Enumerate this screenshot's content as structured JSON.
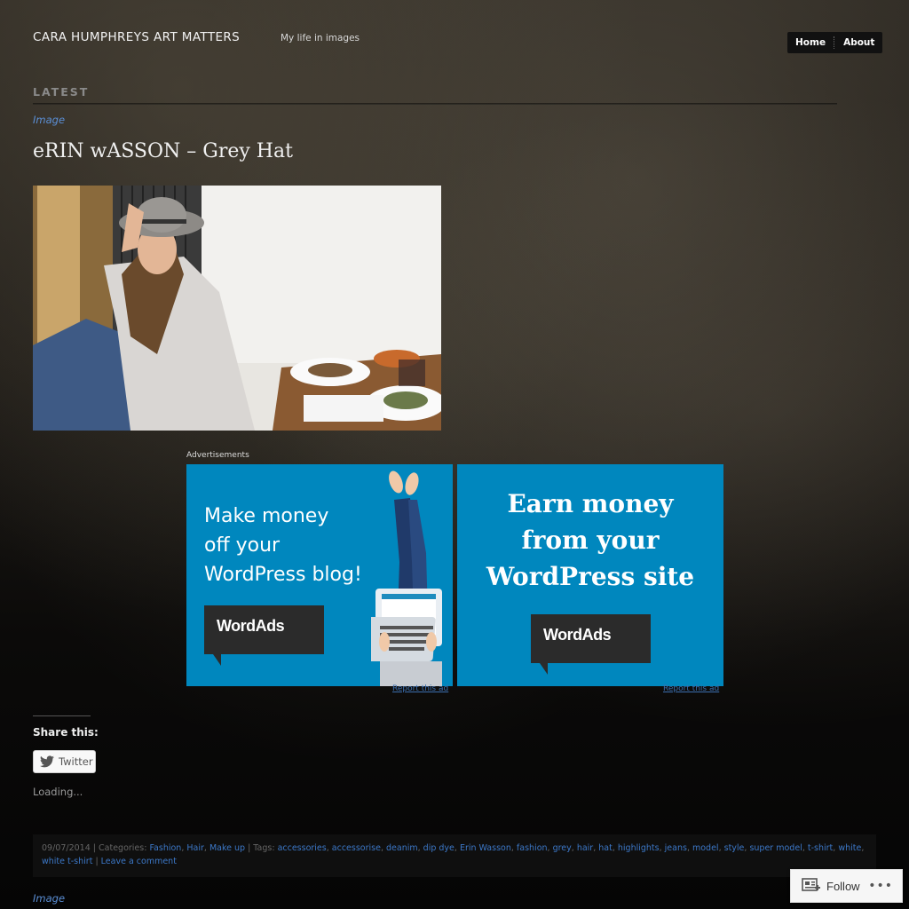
{
  "site": {
    "title": "CARA HUMPHREYS ART MATTERS",
    "tagline": "My life in images"
  },
  "nav": {
    "items": [
      {
        "label": "Home"
      },
      {
        "label": "About"
      }
    ]
  },
  "section_label": "LATEST",
  "post": {
    "format": "Image",
    "title": "eRIN wASSON – Grey Hat",
    "image_alt": "Woman in grey hat seated at a cafe table"
  },
  "ads": {
    "label": "Advertisements",
    "ad1": {
      "headline": "Make money\noff your\nWordPress blog!",
      "brand": "WordAds",
      "report": "Report this ad"
    },
    "ad2": {
      "headline": "Earn money\nfrom your\nWordPress site",
      "brand": "WordAds",
      "report": "Report this ad"
    }
  },
  "share": {
    "title": "Share this:",
    "twitter_label": "Twitter",
    "loading": "Loading..."
  },
  "meta": {
    "date": "09/07/2014",
    "categories_label": "Categories:",
    "categories": [
      "Fashion",
      "Hair",
      "Make up"
    ],
    "tags_label": "Tags:",
    "tags": [
      "accessories",
      "accessorise",
      "deanim",
      "dip dye",
      "Erin Wasson",
      "fashion",
      "grey",
      "hair",
      "hat",
      "highlights",
      "jeans",
      "model",
      "style",
      "super model",
      "t-shirt",
      "white",
      "white t-shirt"
    ],
    "comment_link": "Leave a comment"
  },
  "next_post": {
    "format": "Image"
  },
  "follow": {
    "label": "Follow",
    "more": "•••"
  },
  "colors": {
    "link": "#3c78c8",
    "ad_blue": "#0087be",
    "wordads_dark": "#2b2b2b"
  }
}
